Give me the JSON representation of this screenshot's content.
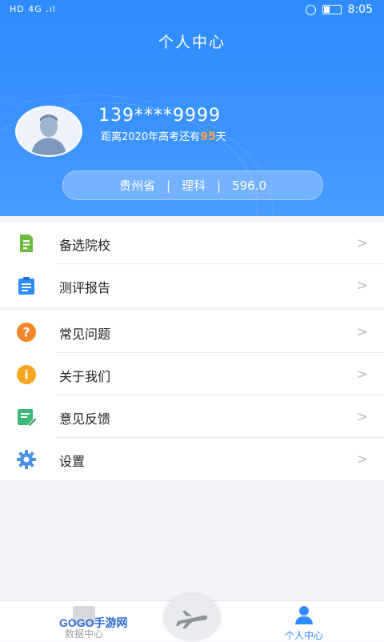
{
  "status": {
    "left": "HD 4G .ıl",
    "time": "8:05"
  },
  "header": {
    "title": "个人中心"
  },
  "profile": {
    "phone": "139****9999",
    "countdown_prefix": "距离2020年高考还有",
    "countdown_days": "95",
    "countdown_suffix": "天",
    "province": "贵州省",
    "track": "理科",
    "score": "596.0",
    "separator": "|"
  },
  "menu_group1": [
    {
      "label": "备选院校",
      "icon": "school-list-icon"
    },
    {
      "label": "测评报告",
      "icon": "report-icon"
    }
  ],
  "menu_group2": [
    {
      "label": "常见问题",
      "icon": "question-icon"
    },
    {
      "label": "关于我们",
      "icon": "info-icon"
    },
    {
      "label": "意见反馈",
      "icon": "feedback-icon"
    },
    {
      "label": "设置",
      "icon": "gear-icon"
    }
  ],
  "chevron": ">",
  "tabbar": {
    "left_label": "数据中心",
    "right_label": "个人中心"
  },
  "watermark": "GOGO手游网"
}
